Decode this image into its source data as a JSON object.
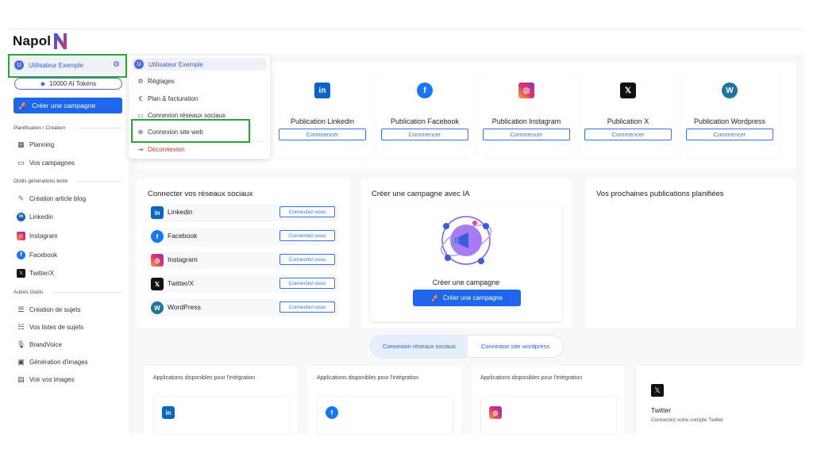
{
  "brand": {
    "name": "Napol"
  },
  "sidebar": {
    "user": {
      "initial": "U",
      "name": "Utilisateur Exemple"
    },
    "tokens": "10000 AI Tokens",
    "create_button": "Créer une campagne",
    "sections": {
      "planning": "Planification / Création",
      "text_tools": "Outils générations texte",
      "other_tools": "Autres Outils"
    },
    "planning_items": [
      "Planning",
      "Vos campagnes"
    ],
    "text_items": [
      "Création article blog",
      "Linkedin",
      "Instagram",
      "Facebook",
      "Twitter/X"
    ],
    "other_items": [
      "Création de sujets",
      "Vos listes de sujets",
      "BrandVoice",
      "Génération d'images",
      "Voir vos images"
    ]
  },
  "dropdown": {
    "user_name": "Utilisateur Exemple",
    "items": [
      "Réglages",
      "Plan & facturation",
      "Connexion réseaux sociaux",
      "Connexion site web"
    ],
    "logout": "Déconnexion"
  },
  "publications": [
    {
      "title": "Publication Linkedin",
      "button": "Commencer",
      "icon": "linkedin-icon",
      "color": "#0a66c2"
    },
    {
      "title": "Publication Facebook",
      "button": "Commencer",
      "icon": "facebook-icon",
      "color": "#1877f2"
    },
    {
      "title": "Publication Instagram",
      "button": "Commencer",
      "icon": "instagram-icon",
      "color": "#e1306c"
    },
    {
      "title": "Publication X",
      "button": "Commencer",
      "icon": "x-icon",
      "color": "#111111"
    },
    {
      "title": "Publication Wordpress",
      "button": "Commencer",
      "icon": "wordpress-icon",
      "color": "#21759b"
    }
  ],
  "connect_social": {
    "title": "Connecter vos réseaux sociaux",
    "networks": [
      {
        "name": "Linkedin",
        "button": "Connectez-vous"
      },
      {
        "name": "Facebook",
        "button": "Connectez-vous"
      },
      {
        "name": "Instagram",
        "button": "Connectez-vous"
      },
      {
        "name": "Twitter/X",
        "button": "Connectez-vous"
      },
      {
        "name": "WordPress",
        "button": "Connectez-vous"
      }
    ]
  },
  "ia_campaign": {
    "title": "Créer une campagne avec IA",
    "label": "Créer une campagne",
    "button": "Créer une campagne"
  },
  "scheduled": {
    "title": "Vos prochaines publications planifiées"
  },
  "tabs": [
    "Connexion réseaux sociaux",
    "Connexion site wordpress"
  ],
  "integrations": {
    "label": "Applications disponibles pour l'intégration",
    "twitter": {
      "title": "Twitter",
      "subtitle": "Connectez votre compte Twitter"
    }
  },
  "colors": {
    "primary": "#1f66ee",
    "highlight": "#27a53a"
  }
}
